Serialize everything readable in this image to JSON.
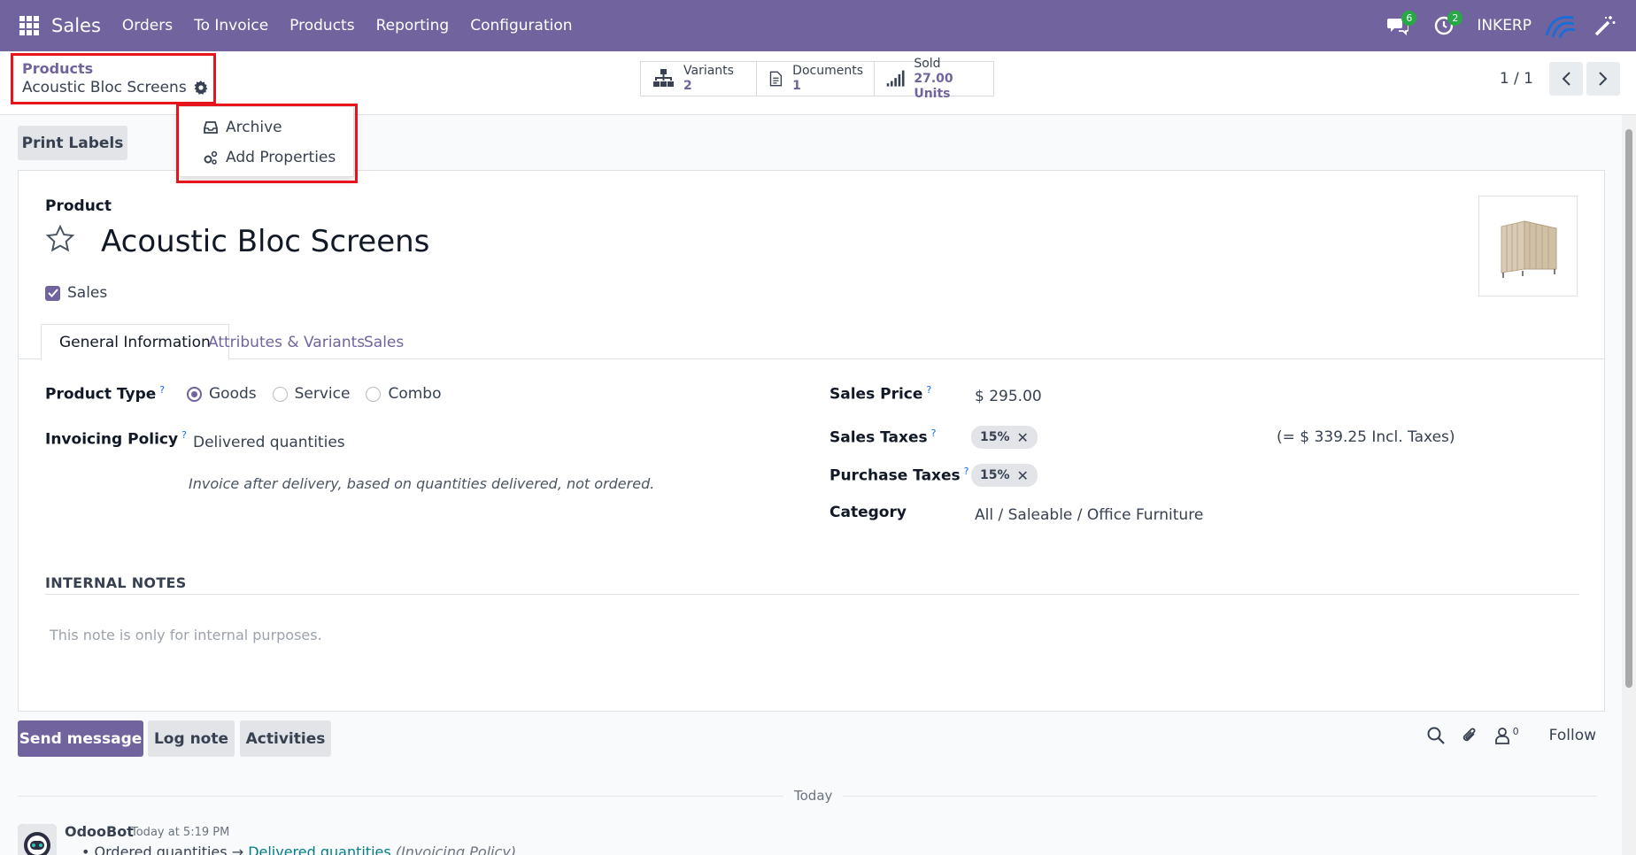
{
  "navbar": {
    "app_name": "Sales",
    "menu": [
      "Orders",
      "To Invoice",
      "Products",
      "Reporting",
      "Configuration"
    ],
    "messages_badge": "6",
    "activities_badge": "2",
    "company": "INKERP",
    "color": "#71639e"
  },
  "breadcrumb": {
    "parent": "Products",
    "current": "Acoustic Bloc Screens"
  },
  "smart_buttons": [
    {
      "label": "Variants",
      "value": "2",
      "icon": "sitemap-icon"
    },
    {
      "label": "Documents",
      "value": "1",
      "icon": "document-icon"
    },
    {
      "label": "Sold",
      "value": "27.00 Units",
      "icon": "bar-signal-icon"
    }
  ],
  "pager": {
    "value": "1 / 1"
  },
  "gear_menu": {
    "items": [
      {
        "label": "Archive",
        "icon": "inbox-icon"
      },
      {
        "label": "Add Properties",
        "icon": "cogs-icon"
      }
    ]
  },
  "actions": {
    "print_labels": "Print Labels"
  },
  "form": {
    "product_label": "Product",
    "product_name": "Acoustic Bloc Screens",
    "sales_checkbox": "Sales",
    "tabs": [
      "General Information",
      "Attributes & Variants",
      "Sales"
    ],
    "product_type": {
      "label": "Product Type",
      "help": "?",
      "options": [
        "Goods",
        "Service",
        "Combo"
      ],
      "selected": "Goods"
    },
    "invoicing_policy": {
      "label": "Invoicing Policy",
      "help": "?",
      "value": "Delivered quantities",
      "hint": "Invoice after delivery, based on quantities delivered, not ordered."
    },
    "sales_price": {
      "label": "Sales Price",
      "help": "?",
      "value": "$ 295.00"
    },
    "sales_taxes": {
      "label": "Sales Taxes",
      "help": "?",
      "tag": "15%",
      "incl": "(= $ 339.25 Incl. Taxes)"
    },
    "purchase_taxes": {
      "label": "Purchase Taxes",
      "help": "?",
      "tag": "15%"
    },
    "category": {
      "label": "Category",
      "value": "All / Saleable / Office Furniture"
    },
    "internal_notes": {
      "title": "INTERNAL NOTES",
      "placeholder": "This note is only for internal purposes."
    }
  },
  "chatter": {
    "send_message": "Send message",
    "log_note": "Log note",
    "activities": "Activities",
    "followers_count": "0",
    "follow": "Follow",
    "date_sep": "Today",
    "message": {
      "author": "OdooBot",
      "time": "Today at 5:19 PM",
      "old_value": "Ordered quantities",
      "arrow": "→",
      "new_value": "Delivered quantities",
      "field": "(Invoicing Policy)"
    }
  }
}
